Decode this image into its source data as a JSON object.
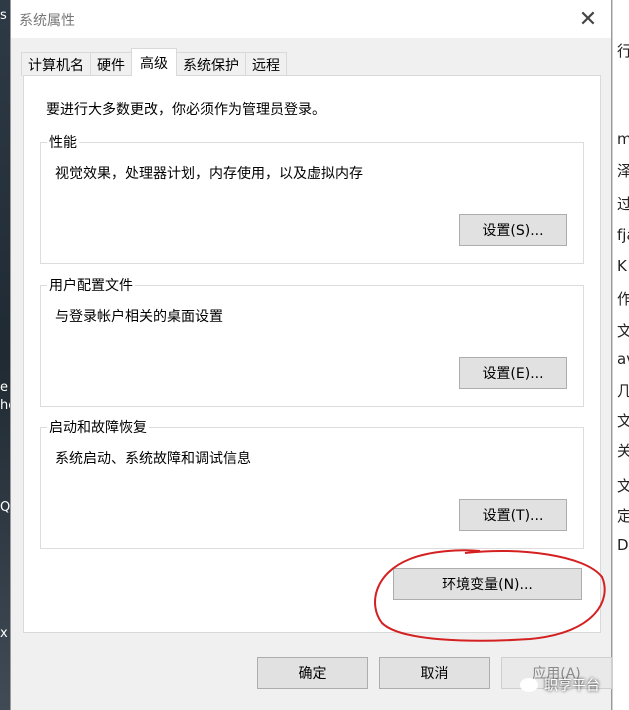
{
  "window": {
    "title": "系统属性"
  },
  "tabs": [
    {
      "label": "计算机名"
    },
    {
      "label": "硬件"
    },
    {
      "label": "高级",
      "active": true
    },
    {
      "label": "系统保护"
    },
    {
      "label": "远程"
    }
  ],
  "notice": "要进行大多数更改，你必须作为管理员登录。",
  "groups": {
    "performance": {
      "label": "性能",
      "desc": "视觉效果，处理器计划，内存使用，以及虚拟内存",
      "button": "设置(S)..."
    },
    "profiles": {
      "label": "用户配置文件",
      "desc": "与登录帐户相关的桌面设置",
      "button": "设置(E)..."
    },
    "startup": {
      "label": "启动和故障恢复",
      "desc": "系统启动、系统故障和调试信息",
      "button": "设置(T)..."
    }
  },
  "env_button": "环境变量(N)...",
  "footer": {
    "ok": "确定",
    "cancel": "取消",
    "apply": "应用(A)"
  },
  "watermark": "职享平台",
  "background_fragments": {
    "left": [
      "s",
      "e",
      "he",
      "Q",
      "x"
    ],
    "right": [
      "行",
      "m",
      "泽",
      "过",
      "fja",
      "K",
      "作",
      "文",
      "av",
      "几",
      "文",
      "关",
      "文",
      "定",
      "D"
    ]
  },
  "annotation": {
    "color": "#d42020"
  }
}
